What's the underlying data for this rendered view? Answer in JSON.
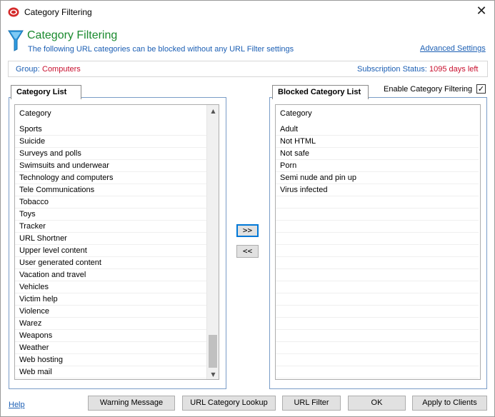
{
  "window": {
    "title": "Category Filtering"
  },
  "header": {
    "title": "Category Filtering",
    "description": "The following URL categories can be blocked without any URL Filter settings",
    "advanced_link": "Advanced Settings"
  },
  "group": {
    "label": "Group:",
    "value": "Computers",
    "subscription_label": "Subscription Status:",
    "subscription_value": "1095 days left"
  },
  "category_list": {
    "tab_label": "Category List",
    "column_header": "Category",
    "items": [
      "Sports",
      "Suicide",
      "Surveys and polls",
      "Swimsuits and underwear",
      "Technology and computers",
      "Tele Communications",
      "Tobacco",
      "Toys",
      "Tracker",
      "URL Shortner",
      "Upper level content",
      "User generated content",
      "Vacation and travel",
      "Vehicles",
      "Victim help",
      "Violence",
      "Warez",
      "Weapons",
      "Weather",
      "Web hosting",
      "Web mail"
    ]
  },
  "blocked_list": {
    "tab_label": "Blocked Category List",
    "column_header": "Category",
    "items": [
      "Adult",
      "Not HTML",
      "Not safe",
      "Porn",
      "Semi nude and pin up",
      "Virus infected"
    ]
  },
  "enable_filtering": {
    "label": "Enable Category Filtering",
    "checked": true,
    "check_glyph": "✓"
  },
  "move": {
    "add_label": ">>",
    "remove_label": "<<"
  },
  "icons": {
    "close": "✕",
    "scroll_up": "▲",
    "scroll_down": "▼"
  },
  "footer": {
    "help": "Help",
    "buttons": [
      "Warning Message",
      "URL Category Lookup",
      "URL Filter",
      "OK",
      "Apply to Clients"
    ]
  },
  "colors": {
    "title_green": "#1a8a2e",
    "link_blue": "#1c5fb4",
    "value_red": "#c8102e"
  }
}
